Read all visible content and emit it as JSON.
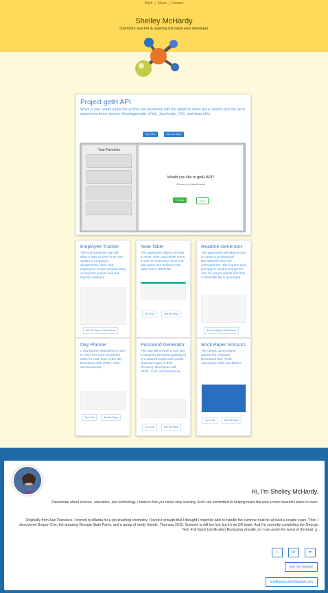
{
  "nav": {
    "items": [
      "Work",
      "About",
      "Contact"
    ]
  },
  "header": {
    "name": "Shelley McHardy",
    "tagline": "chemistry teacher & aspiring full stack web developer"
  },
  "featured": {
    "title": "Project getH.API",
    "description": "When a user needs a pick me up they are presented with the option to either get a random pick me up or select from three choices. Developed with HTML, JavaScript, CSS, and three APIs.",
    "try_label": "Try it Out",
    "repo_label": "See the Repo",
    "shot_left_title": "Your Favorites",
    "shot_question": "Would you like to getH.API?",
    "shot_sub": "Choose your favorite today",
    "shot_btn1": "Try it Out",
    "shot_btn2": "Select"
  },
  "projects": [
    {
      "title": "Employee Tracker",
      "desc": "This command-line app will allow a user to view, enter and update a company's departments, roles, and employees. It was created using an Express.js back end and MySQL database.",
      "btn": "See the Repo & Video Demo"
    },
    {
      "title": "Note Taker",
      "desc": "This application allows the user to enter, save, and delete notes. It uses an Express.js back end and saves and retrieves note data from a JSON file.",
      "try": "Try it Out",
      "repo": "See the Repo"
    },
    {
      "title": "Readme Generator",
      "desc": "This application will allow a user to create a professional README file from the command line. The inquirer npm package is used to prompt the user for project details and then a README file is generated.",
      "btn": "See the Repo & Video Demo"
    },
    {
      "title": "Day Planner",
      "desc": "A day planner that allows a user to enter and save scheduled tasks for each hour of the day. Developed with HTML, CSS, and JavaScript.",
      "try": "Try it Out",
      "repo": "See the Repo"
    },
    {
      "title": "Password Generator",
      "desc": "This app will provide a user with a randomly generated password of a desired length and include character types of their choosing. Developed with HTML, CSS, and JavaScript.",
      "try": "Try it Out",
      "repo": "See the Repo"
    },
    {
      "title": "Rock Paper Scissors",
      "desc": "The classic game played against the computer. Developed with HTML, JavaScript, CSS, and Bulma...",
      "try": "Try it Out",
      "repo": "See the Repo"
    }
  ],
  "about": {
    "greeting": "Hi, I'm Shelley McHardy.",
    "p1": "Passionate about science, education, and technology, I believe that you never stop learning. And I am committed to helping make the web a more beautiful place to learn.",
    "p2": "Originally from San Francisco, I moved to Atlanta for a job teaching chemistry. I loved it enough that I thought I might be able to handle the summer heat for at least a couple years. Then I discovered Dragon Con, the amazing Georgia State Parks, and a group of nerdy friends. That was 2010. Summer is still too hot; but it's an OK trade. And I'm currently completing the Georgia Tech Full Stack Certification Bootcamp virtually, so I can avoid the worst of the heat 🌡",
    "resume": "see my resume",
    "email": "shelleymcq.dev@gmail.com"
  },
  "icons": {
    "github": "github-icon",
    "linkedin": "linkedin-icon",
    "twitter": "twitter-icon"
  },
  "colors": {
    "header": "#ffd95a",
    "background": "#fff9dc",
    "accent": "#3d79c8",
    "footer": "#1f6aa6"
  }
}
